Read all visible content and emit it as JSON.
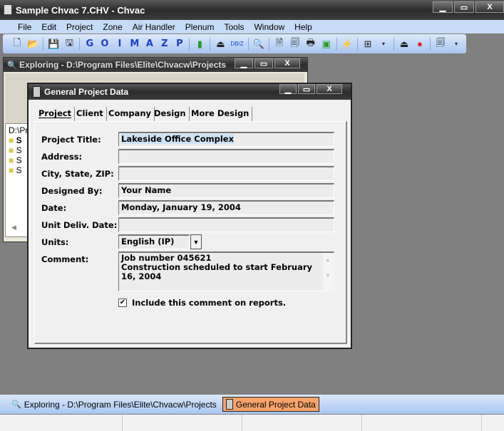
{
  "app": {
    "title": "Sample Chvac 7.CHV - Chvac"
  },
  "menu": [
    "File",
    "Edit",
    "Project",
    "Zone",
    "Air Handler",
    "Plenum",
    "Tools",
    "Window",
    "Help"
  ],
  "toolbar": {
    "letters": [
      "G",
      "O",
      "I",
      "M",
      "A",
      "Z",
      "P"
    ],
    "db_label": "DB/Z"
  },
  "explorer": {
    "title": "Exploring - D:\\Program Files\\Elite\\Chvacw\\Projects",
    "path": "D:\\Pr",
    "folders": [
      "S",
      "S",
      "S",
      "S"
    ]
  },
  "dialog": {
    "title": "General Project Data",
    "tabs": [
      "Project",
      "Client",
      "Company",
      "Design",
      "More Design"
    ],
    "fields": {
      "project_title_label": "Project Title:",
      "project_title": "Lakeside Office Complex",
      "address_label": "Address:",
      "address": "",
      "city_label": "City, State, ZIP:",
      "city": "",
      "designed_by_label": "Designed By:",
      "designed_by": "Your Name",
      "date_label": "Date:",
      "date": "Monday, January 19, 2004",
      "unit_deliv_label": "Unit Deliv. Date:",
      "unit_deliv": "",
      "units_label": "Units:",
      "units": "English (IP)",
      "comment_label": "Comment:",
      "comment": "Job number 045621\nConstruction scheduled to start February 16, 2004"
    },
    "include_comment": {
      "label": "Include this comment on reports.",
      "checked": true
    }
  },
  "taskbar": {
    "items": [
      "Exploring - D:\\Program Files\\Elite\\Chvacw\\Projects",
      "General Project Data"
    ],
    "active_color": "#f7a36a"
  }
}
